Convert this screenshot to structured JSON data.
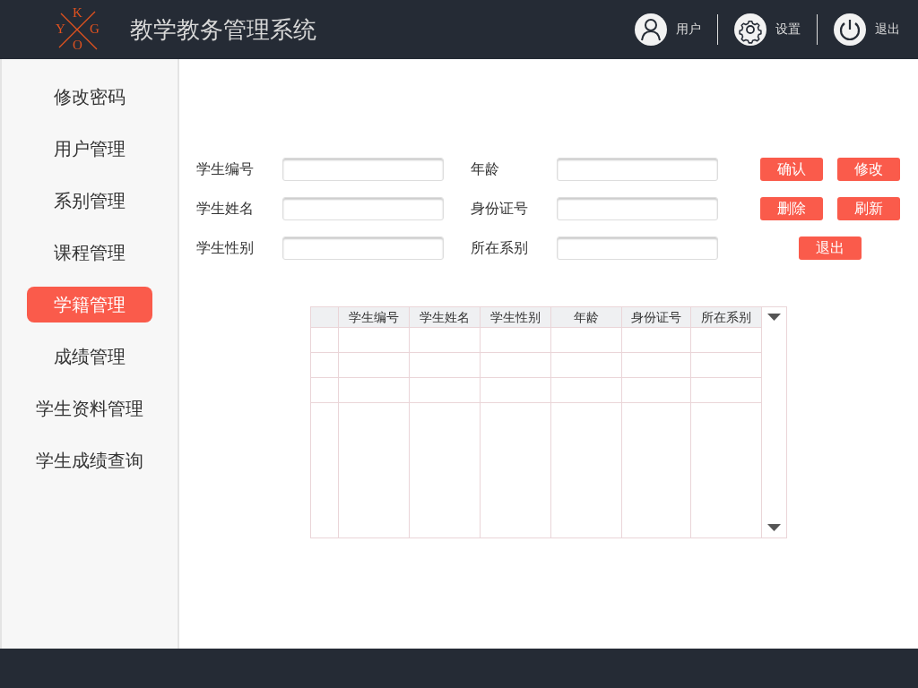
{
  "header": {
    "logo_letters": {
      "top": "K",
      "left": "Y",
      "right": "G",
      "bottom": "O"
    },
    "title": "教学教务管理系统",
    "actions": [
      {
        "kind": "user",
        "label": "用户"
      },
      {
        "kind": "settings",
        "label": "设置"
      },
      {
        "kind": "power",
        "label": "退出"
      }
    ]
  },
  "sidebar": {
    "items": [
      {
        "label": "修改密码",
        "selected": false
      },
      {
        "label": "用户管理",
        "selected": false
      },
      {
        "label": "系别管理",
        "selected": false
      },
      {
        "label": "课程管理",
        "selected": false
      },
      {
        "label": "学籍管理",
        "selected": true
      },
      {
        "label": "成绩管理",
        "selected": false
      },
      {
        "label": "学生资料管理",
        "selected": false
      },
      {
        "label": "学生成绩查询",
        "selected": false
      }
    ]
  },
  "form": {
    "fields": [
      {
        "label": "学生编号"
      },
      {
        "label": "年龄"
      },
      {
        "label": "学生姓名"
      },
      {
        "label": "身份证号"
      },
      {
        "label": "学生性别"
      },
      {
        "label": "所在系别"
      }
    ],
    "buttons": [
      [
        "确认",
        "修改"
      ],
      [
        "删除",
        "刷新"
      ],
      [
        "退出"
      ]
    ]
  },
  "table": {
    "columns": [
      "学生编号",
      "学生姓名",
      "学生性别",
      "年龄",
      "身份证号",
      "所在系别"
    ]
  }
}
